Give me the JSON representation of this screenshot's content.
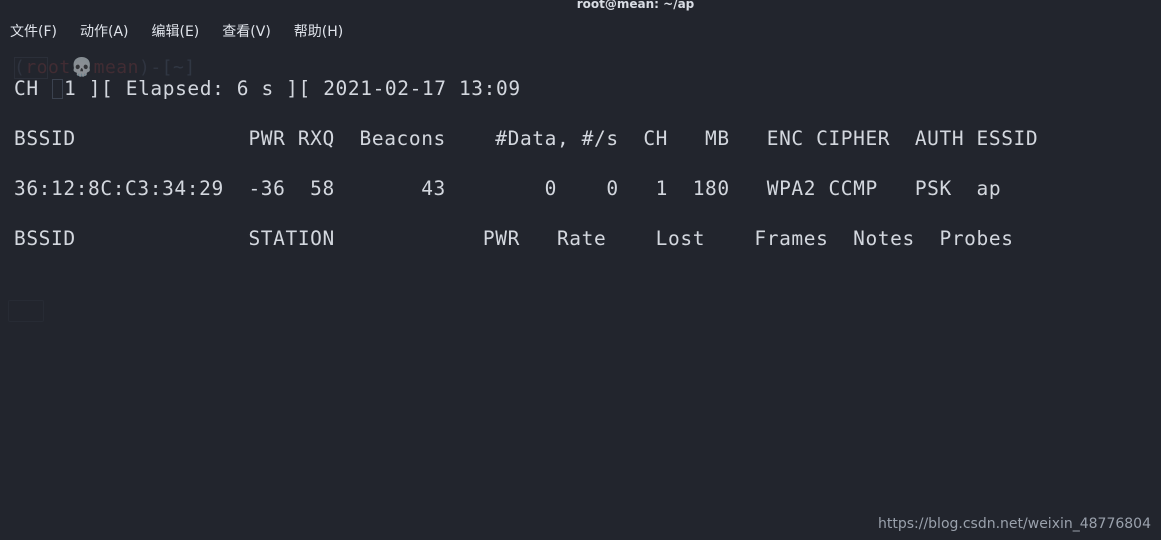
{
  "window": {
    "title": "root@mean: ~/ap"
  },
  "menubar": {
    "items": [
      {
        "label": "文件(F)",
        "name": "menu-file"
      },
      {
        "label": "动作(A)",
        "name": "menu-actions"
      },
      {
        "label": "编辑(E)",
        "name": "menu-edit"
      },
      {
        "label": "查看(V)",
        "name": "menu-view"
      },
      {
        "label": "帮助(H)",
        "name": "menu-help"
      }
    ]
  },
  "terminal": {
    "ghost_prompt": {
      "open_paren": "(",
      "user": "root",
      "skull": "💀",
      "host": "mean",
      "close_paren": ")",
      "dash": "-",
      "path": "[~]"
    },
    "status_line": {
      "prefix": "CH ",
      "channel": "1",
      "middle": " ][ Elapsed: ",
      "elapsed": "6 s",
      "separator": " ][ ",
      "date": "2021-02-17",
      "time": "13:09"
    },
    "ap_table": {
      "header": "BSSID              PWR RXQ  Beacons    #Data, #/s  CH   MB   ENC CIPHER  AUTH ESSID",
      "columns": [
        "BSSID",
        "PWR",
        "RXQ",
        "Beacons",
        "#Data,",
        "#/s",
        "CH",
        "MB",
        "ENC",
        "CIPHER",
        "AUTH",
        "ESSID"
      ],
      "rows": [
        {
          "line": "36:12:8C:C3:34:29  -36  58       43        0    0   1  180   WPA2 CCMP   PSK  ap",
          "bssid": "36:12:8C:C3:34:29",
          "pwr": "-36",
          "rxq": "58",
          "beacons": "43",
          "data": "0",
          "per_sec": "0",
          "ch": "1",
          "mb": "180",
          "enc": "WPA2",
          "cipher": "CCMP",
          "auth": "PSK",
          "essid": "ap"
        }
      ]
    },
    "station_table": {
      "header": "BSSID              STATION            PWR   Rate    Lost    Frames  Notes  Probes",
      "columns": [
        "BSSID",
        "STATION",
        "PWR",
        "Rate",
        "Lost",
        "Frames",
        "Notes",
        "Probes"
      ],
      "rows": []
    }
  },
  "watermark": {
    "text": "https://blog.csdn.net/weixin_48776804"
  }
}
